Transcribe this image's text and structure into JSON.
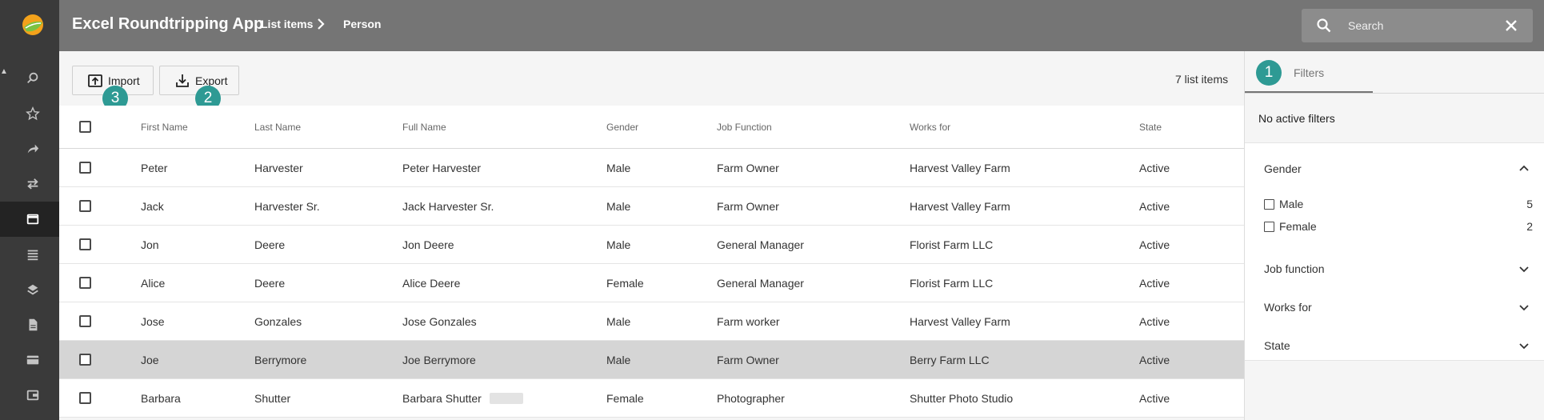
{
  "header": {
    "app_title": "Excel Roundtripping App",
    "breadcrumb": [
      "List items",
      "Person"
    ],
    "search_placeholder": "Search"
  },
  "rail": {
    "icons": [
      "search-icon",
      "star-icon",
      "share-icon",
      "swap-icon",
      "window-icon",
      "list-icon",
      "layers-icon",
      "document-icon",
      "card-icon",
      "wallet-icon"
    ]
  },
  "toolbar": {
    "import_label": "Import",
    "export_label": "Export",
    "item_count": "7 list items"
  },
  "badges": [
    "1",
    "2",
    "3"
  ],
  "table": {
    "columns": [
      "First Name",
      "Last Name",
      "Full Name",
      "Gender",
      "Job Function",
      "Works for",
      "State"
    ],
    "rows": [
      [
        "Peter",
        "Harvester",
        "Peter Harvester",
        "Male",
        "Farm Owner",
        "Harvest Valley Farm",
        "Active"
      ],
      [
        "Jack",
        "Harvester Sr.",
        "Jack Harvester Sr.",
        "Male",
        "Farm Owner",
        "Harvest Valley Farm",
        "Active"
      ],
      [
        "Jon",
        "Deere",
        "Jon Deere",
        "Male",
        "General Manager",
        "Florist Farm LLC",
        "Active"
      ],
      [
        "Alice",
        "Deere",
        "Alice Deere",
        "Female",
        "General Manager",
        "Florist Farm LLC",
        "Active"
      ],
      [
        "Jose",
        "Gonzales",
        "Jose Gonzales",
        "Male",
        "Farm worker",
        "Harvest Valley Farm",
        "Active"
      ],
      [
        "Joe",
        "Berrymore",
        "Joe Berrymore",
        "Male",
        "Farm Owner",
        "Berry Farm LLC",
        "Active"
      ],
      [
        "Barbara",
        "Shutter",
        "Barbara Shutter",
        "Female",
        "Photographer",
        "Shutter Photo Studio",
        "Active"
      ]
    ]
  },
  "filters": {
    "tab_label": "Filters",
    "no_active": "No active filters",
    "sections": [
      "Gender",
      "Job function",
      "Works for",
      "State"
    ],
    "gender_options": [
      {
        "label": "Male",
        "count": "5"
      },
      {
        "label": "Female",
        "count": "2"
      }
    ]
  },
  "colors": {
    "header_bg": "#757575",
    "rail_bg": "#3a3a3a",
    "accent_teal": "#2e9a94",
    "selected_row": "#d5d5d5"
  }
}
